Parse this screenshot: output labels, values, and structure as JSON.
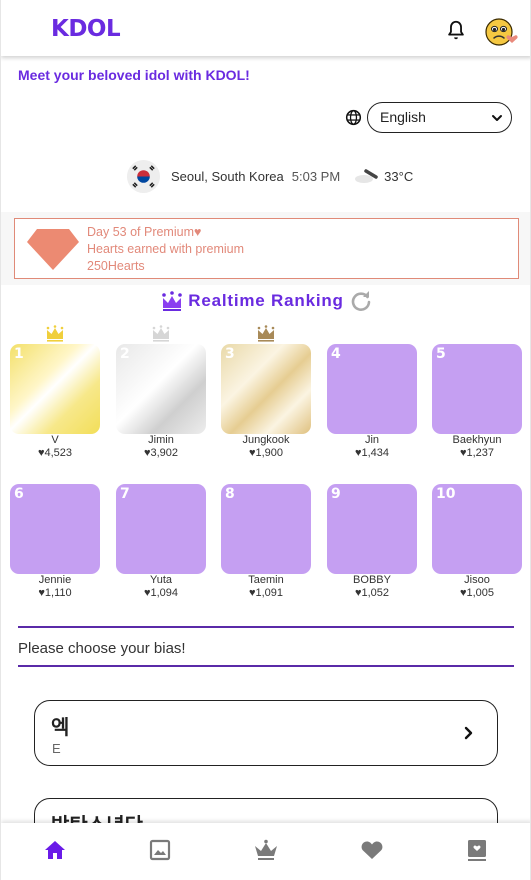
{
  "header": {
    "logo": "KDOL",
    "icons": [
      "bell-icon",
      "avatar-emoji-icon"
    ]
  },
  "tagline": "Meet your beloved idol with KDOL!",
  "language": {
    "selected": "English",
    "icon": "globe-icon"
  },
  "location": {
    "city": "Seoul, South Korea",
    "time": "5:03 PM",
    "temperature": "33°C",
    "weather_icon": "cloudy-icon",
    "flag_icon": "south-korea-flag-icon"
  },
  "premium": {
    "day_line": "Day 53 of Premium♥",
    "earned_label": "Hearts earned with premium",
    "hearts": "250Hearts",
    "accent_color": "#e2897a"
  },
  "ranking": {
    "title": "Realtime Ranking",
    "items": [
      {
        "rank": "1",
        "name": "V",
        "hearts": "♥4,523",
        "medal": "gold"
      },
      {
        "rank": "2",
        "name": "Jimin",
        "hearts": "♥3,902",
        "medal": "silver"
      },
      {
        "rank": "3",
        "name": "Jungkook",
        "hearts": "♥1,900",
        "medal": "bronze"
      },
      {
        "rank": "4",
        "name": "Jin",
        "hearts": "♥1,434",
        "medal": ""
      },
      {
        "rank": "5",
        "name": "Baekhyun",
        "hearts": "♥1,237",
        "medal": ""
      },
      {
        "rank": "6",
        "name": "Jennie",
        "hearts": "♥1,110",
        "medal": ""
      },
      {
        "rank": "7",
        "name": "Yuta",
        "hearts": "♥1,094",
        "medal": ""
      },
      {
        "rank": "8",
        "name": "Taemin",
        "hearts": "♥1,091",
        "medal": ""
      },
      {
        "rank": "9",
        "name": "BOBBY",
        "hearts": "♥1,052",
        "medal": ""
      },
      {
        "rank": "10",
        "name": "Jisoo",
        "hearts": "♥1,005",
        "medal": ""
      }
    ]
  },
  "bias": {
    "prompt": "Please choose your bias!",
    "items": [
      {
        "korean": "엑",
        "english": "E"
      },
      {
        "korean": "방탄소년단",
        "english": ""
      }
    ]
  },
  "bottom_nav": [
    {
      "name": "home",
      "active": true
    },
    {
      "name": "gallery",
      "active": false
    },
    {
      "name": "ranking",
      "active": false
    },
    {
      "name": "favorites",
      "active": false
    },
    {
      "name": "book",
      "active": false
    }
  ],
  "colors": {
    "brand": "#6a2be0",
    "tile": "#c59ff2",
    "divider": "#5a2aa8",
    "nav_active": "#6a1be8",
    "nav_inactive": "#7a7a7a"
  }
}
